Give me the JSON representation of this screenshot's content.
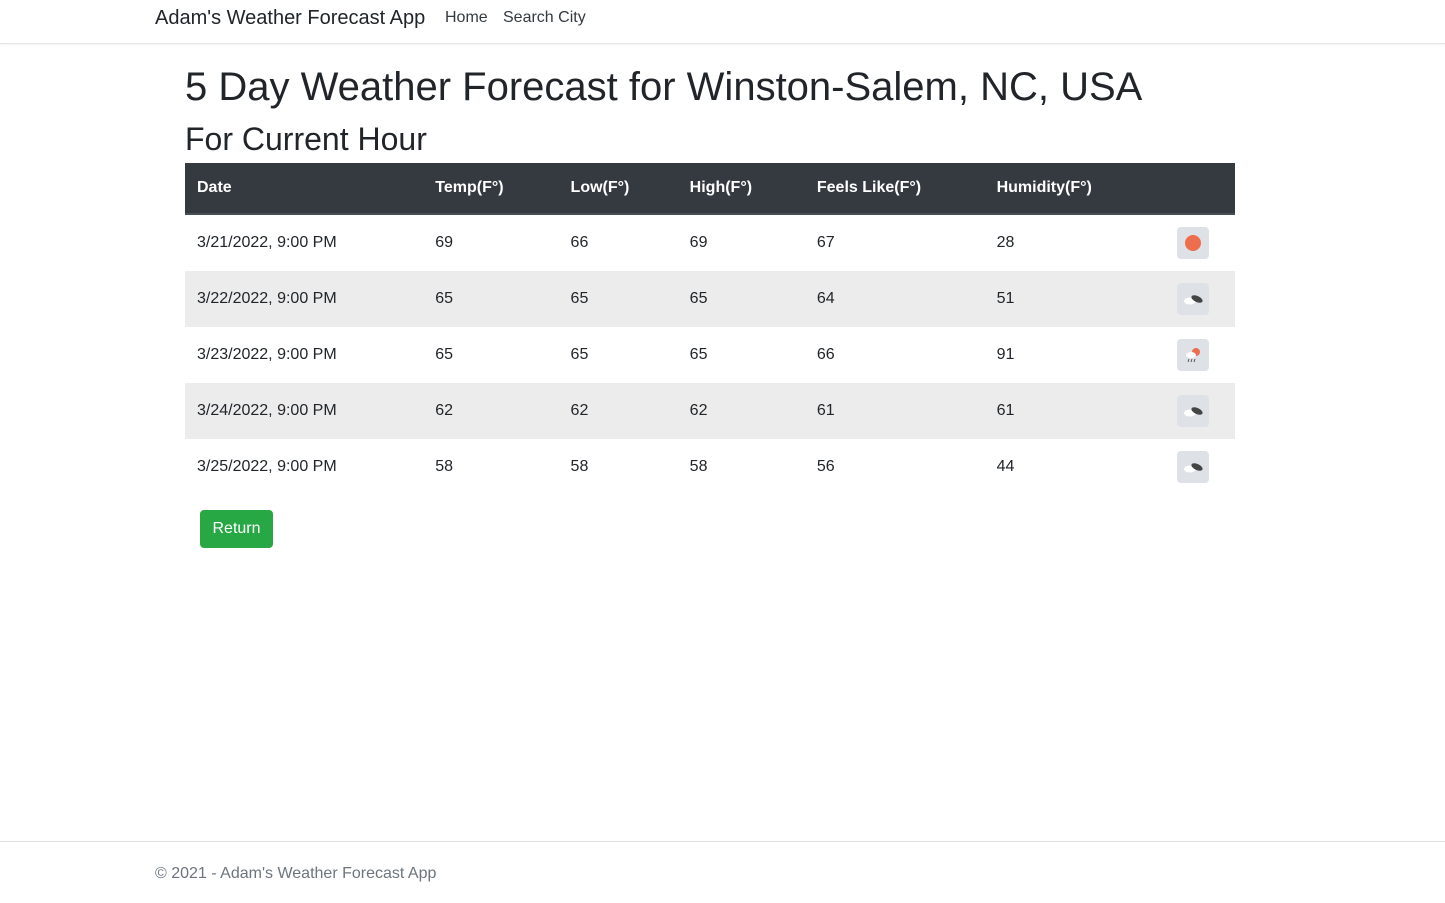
{
  "navbar": {
    "brand": "Adam's Weather Forecast App",
    "links": [
      "Home",
      "Search City"
    ]
  },
  "main": {
    "title": "5 Day Weather Forecast for Winston-Salem, NC, USA",
    "subtitle": "For Current Hour",
    "table": {
      "headers": [
        "Date",
        "Temp(F°)",
        "Low(F°)",
        "High(F°)",
        "Feels Like(F°)",
        "Humidity(F°)"
      ],
      "rows": [
        {
          "date": "3/21/2022, 9:00 PM",
          "temp": "69",
          "low": "66",
          "high": "69",
          "feels": "67",
          "humidity": "28",
          "icon": "sun-icon"
        },
        {
          "date": "3/22/2022, 9:00 PM",
          "temp": "65",
          "low": "65",
          "high": "65",
          "feels": "64",
          "humidity": "51",
          "icon": "broken-clouds-icon"
        },
        {
          "date": "3/23/2022, 9:00 PM",
          "temp": "65",
          "low": "65",
          "high": "65",
          "feels": "66",
          "humidity": "91",
          "icon": "rain-icon"
        },
        {
          "date": "3/24/2022, 9:00 PM",
          "temp": "62",
          "low": "62",
          "high": "62",
          "feels": "61",
          "humidity": "61",
          "icon": "broken-clouds-icon"
        },
        {
          "date": "3/25/2022, 9:00 PM",
          "temp": "58",
          "low": "58",
          "high": "58",
          "feels": "56",
          "humidity": "44",
          "icon": "broken-clouds-icon"
        }
      ]
    },
    "return_label": "Return"
  },
  "footer": {
    "text": "© 2021 - Adam's Weather Forecast App"
  },
  "colors": {
    "header_bg": "#343a40",
    "stripe": "#ececec",
    "button": "#28a745",
    "sun": "#ec6e4c"
  }
}
